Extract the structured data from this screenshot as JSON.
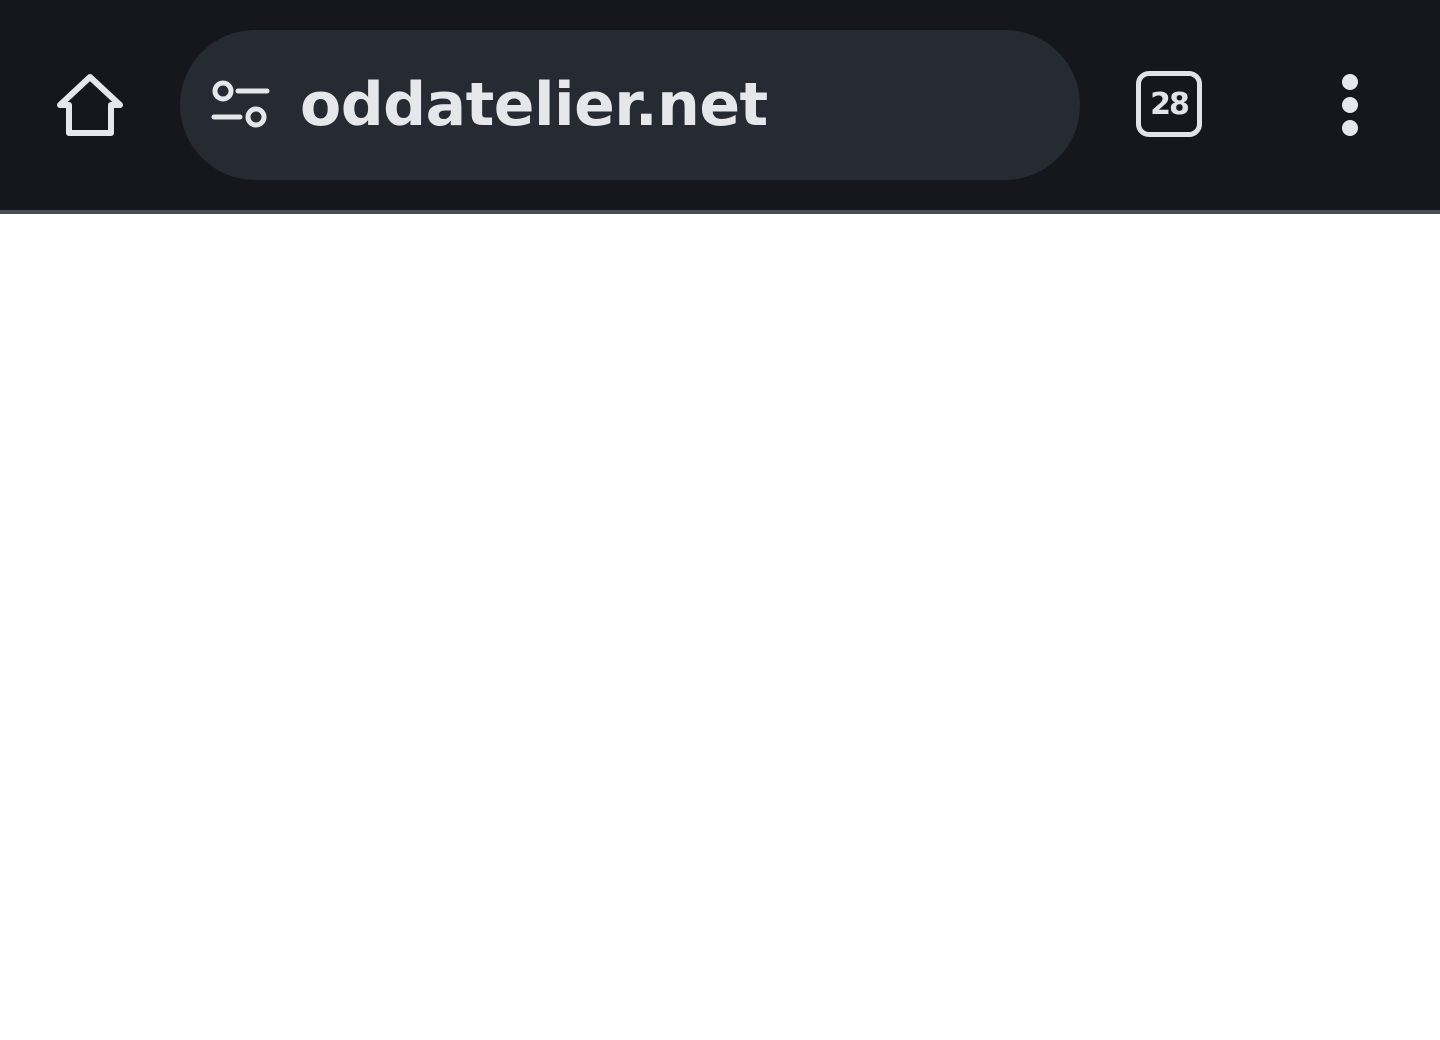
{
  "browser": {
    "toolbar": {
      "home_icon": "home-icon",
      "site_settings_icon": "tune-icon",
      "url": "oddatelier.net",
      "tab_count": "28",
      "menu_icon": "more-vert-icon"
    },
    "colors": {
      "toolbar_background": "#15171c",
      "omnibox_background": "#262a33",
      "foreground": "#e6e7ea",
      "page_background": "#ffffff"
    }
  }
}
